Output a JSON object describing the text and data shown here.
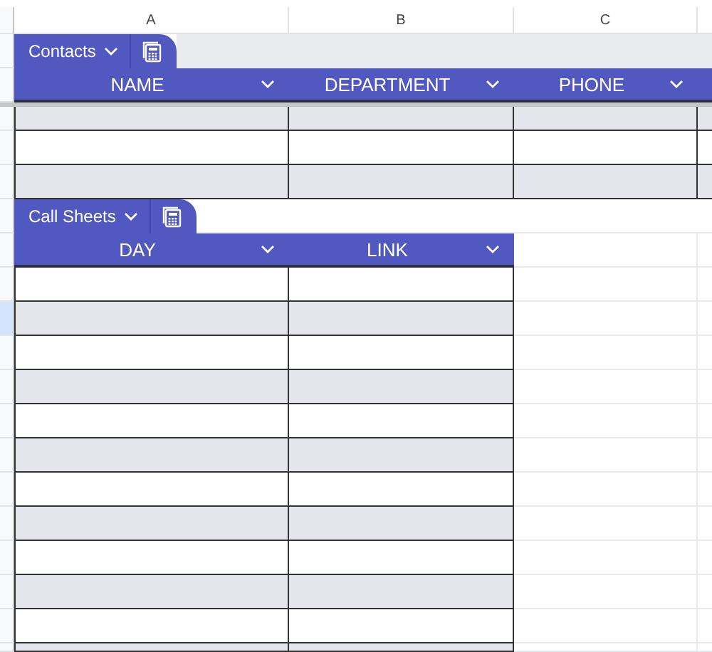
{
  "column_headers": [
    "A",
    "B",
    "C"
  ],
  "tables": [
    {
      "name": "Contacts",
      "frozen": true,
      "continues_right": true,
      "columns": [
        "NAME",
        "DEPARTMENT",
        "PHONE"
      ],
      "rows": [
        {
          "banded": true,
          "selected": false
        },
        {
          "banded": false,
          "selected": false
        },
        {
          "banded": true,
          "selected": false
        }
      ]
    },
    {
      "name": "Call Sheets",
      "frozen": false,
      "continues_right": false,
      "columns": [
        "DAY",
        "LINK"
      ],
      "rows": [
        {
          "banded": false,
          "selected": false
        },
        {
          "banded": true,
          "selected": true
        },
        {
          "banded": false,
          "selected": false
        },
        {
          "banded": true,
          "selected": false
        },
        {
          "banded": false,
          "selected": false
        },
        {
          "banded": true,
          "selected": false
        },
        {
          "banded": false,
          "selected": false
        },
        {
          "banded": true,
          "selected": false
        },
        {
          "banded": false,
          "selected": false
        },
        {
          "banded": true,
          "selected": false
        },
        {
          "banded": false,
          "selected": false
        },
        {
          "banded": true,
          "selected": false
        }
      ]
    }
  ]
}
